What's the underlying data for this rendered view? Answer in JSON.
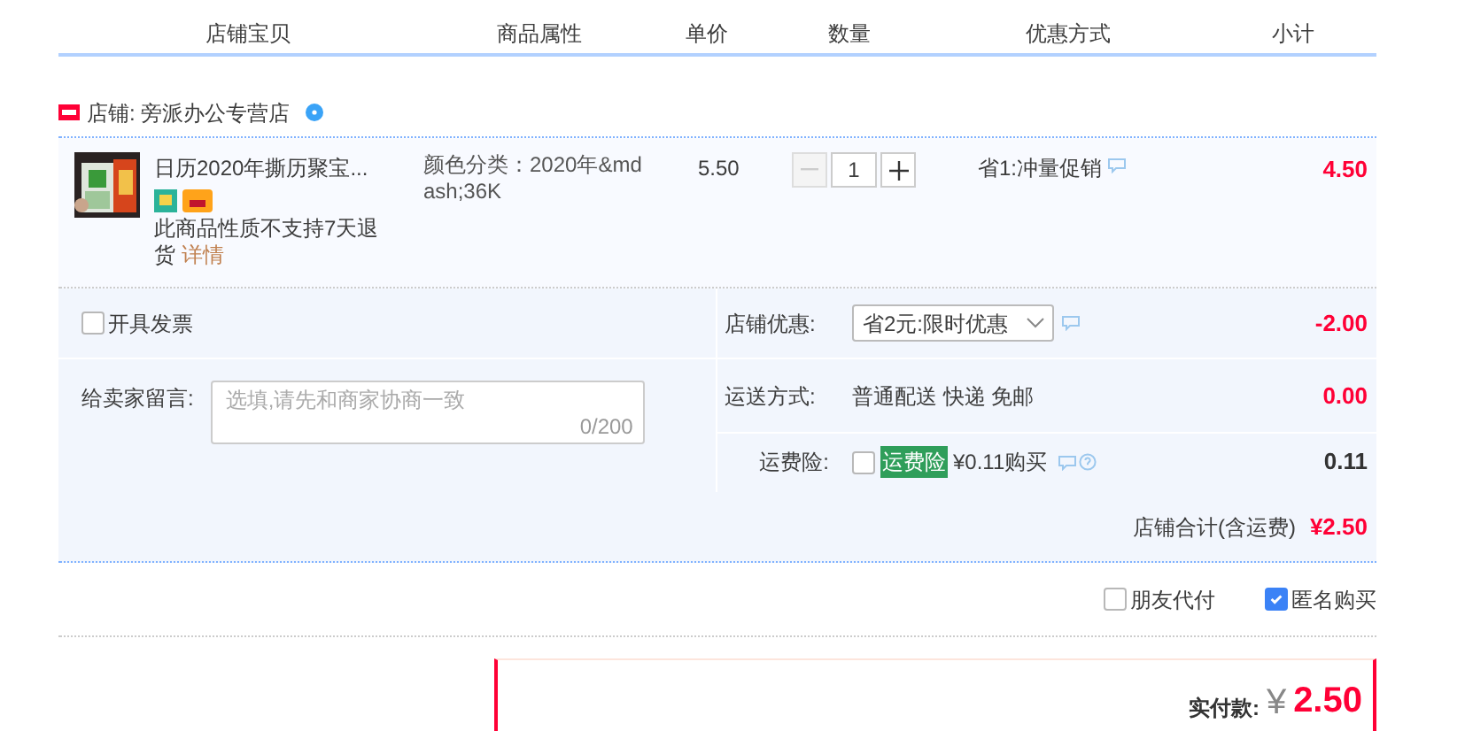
{
  "columns": [
    "店铺宝贝",
    "商品属性",
    "单价",
    "数量",
    "优惠方式",
    "小计"
  ],
  "shop": {
    "label": "店铺: 旁派办公专营店"
  },
  "item": {
    "title": "日历2020年撕历聚宝...",
    "attribute": "颜色分类：2020年&mdash;36K",
    "notice": "此商品性质不支持7天退货",
    "detail_link": "详情",
    "unit_price": "5.50",
    "quantity": "1",
    "minus_disabled": true,
    "plus_disabled": false,
    "promotion": "省1:冲量促销",
    "subtotal": "4.50"
  },
  "invoice": {
    "label": "开具发票",
    "checked": false
  },
  "message": {
    "label": "给卖家留言:",
    "placeholder": "选填,请先和商家协商一致",
    "counter": "0/200"
  },
  "shop_discount": {
    "label": "店铺优惠:",
    "selected_option": "省2元:限时优惠",
    "amount": "-2.00"
  },
  "shipping": {
    "label": "运送方式:",
    "value": "普通配送 快递 免邮",
    "amount": "0.00"
  },
  "insurance": {
    "label": "运费险:",
    "checked": false,
    "badge": "运费险",
    "price": "¥0.11购买",
    "amount": "0.11"
  },
  "shop_total": {
    "label": "店铺合计(含运费)",
    "amount": "¥2.50"
  },
  "options": [
    {
      "label": "朋友代付",
      "checked": false
    },
    {
      "label": "匿名购买",
      "checked": true
    }
  ],
  "payment": {
    "label": "实付款:",
    "currency": "¥",
    "amount": "2.50"
  }
}
